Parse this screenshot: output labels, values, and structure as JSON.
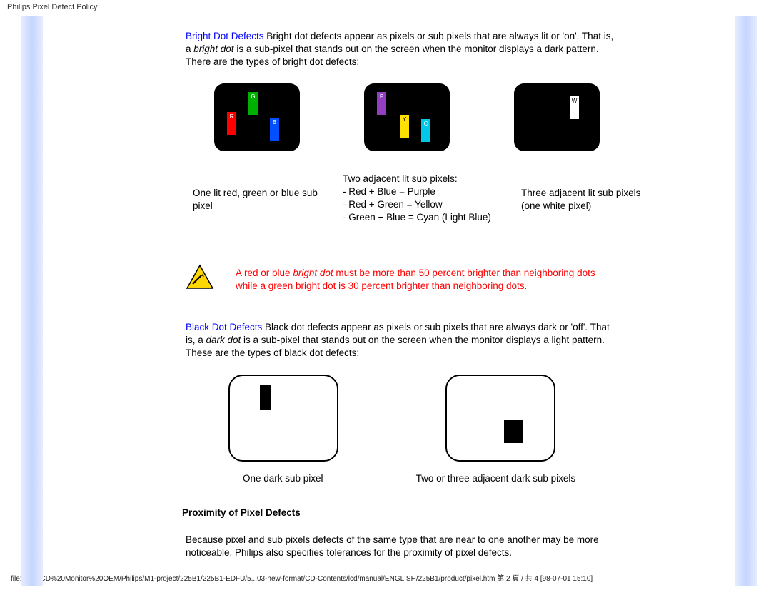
{
  "header": {
    "title": "Philips Pixel Defect Policy"
  },
  "bright": {
    "link": "Bright Dot Defects",
    "text1": " Bright dot defects appear as pixels or sub pixels that are always lit or 'on'. That is, a ",
    "italic": "bright dot",
    "text2": " is a sub-pixel that stands out on the screen when the monitor displays a dark pattern. There are the types of bright dot defects:"
  },
  "captions": {
    "c1": "One lit red, green or blue sub pixel",
    "c2_l1": "Two adjacent lit sub pixels:",
    "c2_l2": "- Red + Blue = Purple",
    "c2_l3": "- Red + Green = Yellow",
    "c2_l4": "- Green + Blue = Cyan (Light Blue)",
    "c3_l1": "Three adjacent lit sub pixels",
    "c3_l2": "(one white pixel)"
  },
  "hazard": {
    "t1": "A red or blue ",
    "italic": "bright dot",
    "t2": " must be more than 50 percent brighter than neighboring dots while a green bright dot is 30 percent brighter than neighboring dots."
  },
  "black": {
    "link": "Black Dot Defects",
    "text1": " Black dot defects appear as pixels or sub pixels that are always dark or 'off'. That is, a ",
    "italic": "dark dot",
    "text2": " is a sub-pixel that stands out on the screen when the monitor displays a light pattern. These are the types of black dot defects:"
  },
  "dark_captions": {
    "c1": "One dark sub pixel",
    "c2": "Two or three adjacent dark sub pixels"
  },
  "proximity": {
    "heading": "Proximity of Pixel Defects",
    "body": "Because pixel and sub pixels defects of the same type that are near to one another may be more noticeable, Philips also specifies tolerances for the proximity of pixel defects."
  },
  "footer": {
    "path": "file:///E|/LCD%20Monitor%20OEM/Philips/M1-project/225B1/225B1-EDFU/5...03-new-format/CD-Contents/lcd/manual/ENGLISH/225B1/product/pixel.htm 第 2 頁 / 共 4 [98-07-01 15:10]"
  },
  "icons": {
    "r": "R",
    "g": "G",
    "b": "B",
    "p": "P",
    "y": "Y",
    "c": "C",
    "w": "W"
  }
}
